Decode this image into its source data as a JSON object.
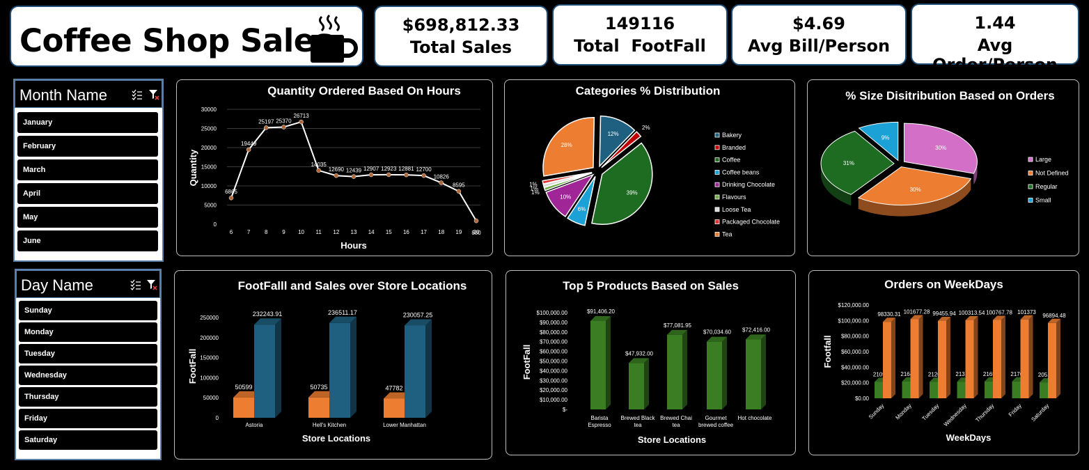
{
  "header": {
    "title": "Coffee Shop Sales"
  },
  "kpis": [
    {
      "value": "$698,812.33",
      "label": "Total Sales"
    },
    {
      "value": "149116",
      "label": "Total  FootFall"
    },
    {
      "value": "$4.69",
      "label": "Avg Bill/Person"
    },
    {
      "value": "1.44",
      "label": "Avg Order/Person"
    }
  ],
  "month_slicer": {
    "title": "Month Name",
    "items": [
      "January",
      "February",
      "March",
      "April",
      "May",
      "June"
    ]
  },
  "day_slicer": {
    "title": "Day Name",
    "items": [
      "Sunday",
      "Monday",
      "Tuesday",
      "Wednesday",
      "Thursday",
      "Friday",
      "Saturday"
    ]
  },
  "colors": {
    "orange": "#ed7d31",
    "blue": "#1f6080",
    "green": "#3a7d22",
    "panel_border": "#bfbfbf"
  },
  "chart_data": [
    {
      "id": "hours",
      "type": "line",
      "title": "Quantity Ordered Based On Hours",
      "xlabel": "Hours",
      "ylabel": "Quantity",
      "x": [
        6,
        7,
        8,
        9,
        10,
        11,
        12,
        13,
        14,
        15,
        16,
        17,
        18,
        19,
        20
      ],
      "values": [
        6865,
        19449,
        25197,
        25370,
        26713,
        14035,
        12690,
        12439,
        12907,
        12923,
        12881,
        12700,
        10826,
        8595,
        880
      ],
      "yticks": [
        0,
        5000,
        10000,
        15000,
        20000,
        25000,
        30000
      ],
      "ylim": [
        0,
        30000
      ],
      "grid": true
    },
    {
      "id": "categories",
      "type": "pie",
      "title": "Categories % Distribution",
      "legend_position": "right",
      "slices": [
        {
          "label": "Bakery",
          "value": 12,
          "text": "12%",
          "color": "#1f6080"
        },
        {
          "label": "Branded",
          "value": 2,
          "text": "2%",
          "color": "#c00000"
        },
        {
          "label": "Coffee",
          "value": 39,
          "text": "39%",
          "color": "#1e6b22"
        },
        {
          "label": "Coffee beans",
          "value": 6,
          "text": "6%",
          "color": "#1ba1d6"
        },
        {
          "label": "Drinking Chocolate",
          "value": 10,
          "text": "10%",
          "color": "#a02596"
        },
        {
          "label": "Flavours",
          "value": 1,
          "text": "1%",
          "color": "#70ad47"
        },
        {
          "label": "Loose Tea",
          "value": 1,
          "text": "1%",
          "color": "#d9d9d9"
        },
        {
          "label": "Packaged Chocolate",
          "value": 1,
          "text": "1%",
          "color": "#e0312f"
        },
        {
          "label": "Tea",
          "value": 28,
          "text": "28%",
          "color": "#ed7d31"
        }
      ]
    },
    {
      "id": "sizes",
      "type": "pie",
      "title": "% Size Disitribution Based on Orders",
      "legend_position": "right",
      "slices": [
        {
          "label": "Large",
          "value": 30,
          "text": "30%",
          "color": "#d36fc6"
        },
        {
          "label": "Not Defined",
          "value": 30,
          "text": "30%",
          "color": "#ed7d31"
        },
        {
          "label": "Regular",
          "value": 31,
          "text": "31%",
          "color": "#1e6b22"
        },
        {
          "label": "Small",
          "value": 9,
          "text": "9%",
          "color": "#1ba1d6"
        }
      ]
    },
    {
      "id": "stores",
      "type": "bar",
      "title": "FootFalll and Sales over Store Locations",
      "xlabel": "Store Locations",
      "ylabel": "FootFall",
      "categories": [
        "Astoria",
        "Hell's Kitchen",
        "Lower Manhattan"
      ],
      "series": [
        {
          "values": [
            50599,
            50735,
            47782
          ],
          "labels": [
            "50599",
            "50735",
            "47782"
          ],
          "color": "#ed7d31"
        },
        {
          "values": [
            232243.91,
            236511.17,
            230057.25
          ],
          "labels": [
            "232243.91",
            "236511.17",
            "230057.25"
          ],
          "color": "#1f6080"
        }
      ],
      "yticks": [
        "0",
        "50000",
        "100000",
        "150000",
        "200000",
        "250000"
      ],
      "ylim": [
        0,
        250000
      ]
    },
    {
      "id": "top5",
      "type": "bar",
      "title": "Top 5 Products Based on Sales",
      "xlabel": "Store Locations",
      "ylabel": "FootFall",
      "categories": [
        [
          "Barista",
          "Espresso"
        ],
        [
          "Brewed Black",
          "tea"
        ],
        [
          "Brewed Chai",
          "tea"
        ],
        [
          "Gourmet",
          "brewed coffee"
        ],
        [
          "Hot chocolate"
        ]
      ],
      "values": [
        91406.2,
        47932.0,
        77081.95,
        70034.6,
        72416.0
      ],
      "labels": [
        "$91,406.20",
        "$47,932.00",
        "$77,081.95",
        "$70,034.60",
        "$72,416.00"
      ],
      "color": "#3a7d22",
      "yticks": [
        "$-",
        "$10,000.00",
        "$20,000.00",
        "$30,000.00",
        "$40,000.00",
        "$50,000.00",
        "$60,000.00",
        "$70,000.00",
        "$80,000.00",
        "$90,000.00",
        "$100,000.00"
      ],
      "ylim": [
        0,
        100000
      ]
    },
    {
      "id": "weekdays",
      "type": "bar",
      "title": "Orders on WeekDays",
      "xlabel": "WeekDays",
      "ylabel": "Footfall",
      "categories": [
        "Sunday",
        "Monday",
        "Tuesday",
        "Wednesday",
        "Thursday",
        "Friday",
        "Saturday"
      ],
      "series": [
        {
          "values": [
            21096,
            21643,
            21202,
            21310,
            21654,
            21701,
            20510
          ],
          "labels": [
            "21096",
            "21643",
            "21202",
            "21310",
            "21654",
            "21701",
            "20510"
          ],
          "color": "#3a7d22"
        },
        {
          "values": [
            98330.31,
            101677.28,
            99455.94,
            100313.54,
            100767.78,
            101373,
            96894.48
          ],
          "labels": [
            "98330.31",
            "101677.28",
            "99455.94",
            "100313.54",
            "100767.78",
            "101373",
            "96894.48"
          ],
          "color": "#ed7d31"
        }
      ],
      "yticks": [
        "$0.00",
        "$20,000.00",
        "$40,000.00",
        "$60,000.00",
        "$80,000.00",
        "$100,000.00",
        "$120,000.00"
      ],
      "ylim": [
        0,
        120000
      ]
    }
  ]
}
